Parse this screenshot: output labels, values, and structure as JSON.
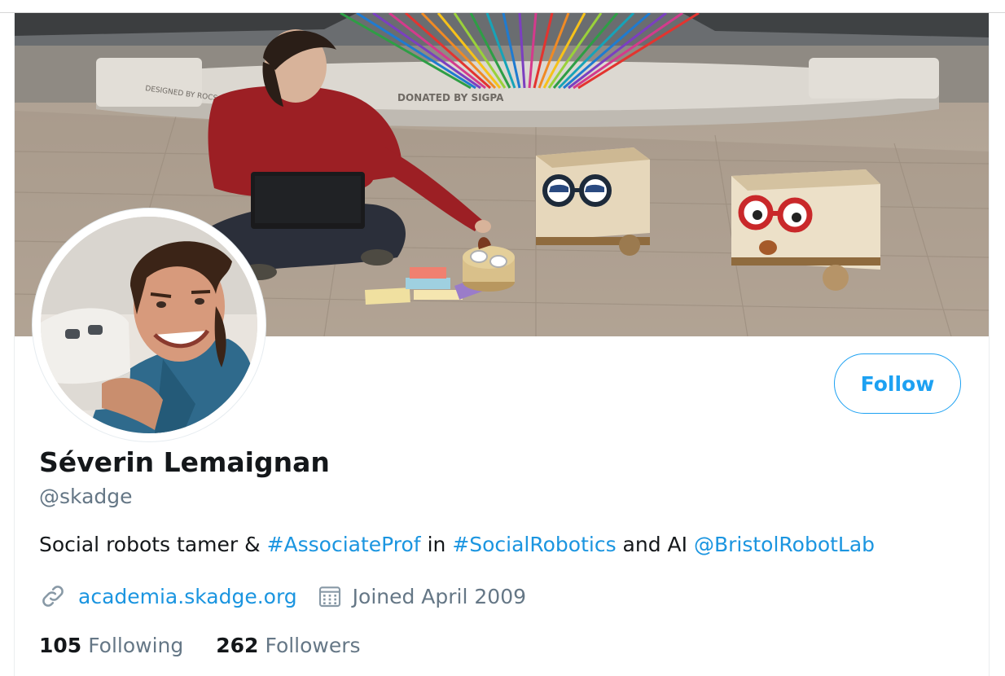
{
  "profile": {
    "display_name": "Séverin Lemaignan",
    "handle": "@skadge",
    "follow_label": "Follow",
    "bio": {
      "text_1": "Social robots tamer & ",
      "hashtag_1": "#AssociateProf",
      "text_2": " in ",
      "hashtag_2": "#SocialRobotics",
      "text_3": " and AI ",
      "mention": "@BristolRobotLab"
    },
    "website": "academia.skadge.org",
    "joined": "Joined April 2009",
    "following_count": "105",
    "following_label": "Following",
    "followers_count": "262",
    "followers_label": "Followers"
  },
  "banner": {
    "sign_left": "DESIGNED BY ROCS",
    "sign_center": "DONATED BY SIGPA"
  },
  "icons": {
    "website": "link-icon",
    "joined": "calendar-icon"
  },
  "colors": {
    "accent": "#1da1f2",
    "link": "#1b95e0",
    "text": "#14171a",
    "secondary": "#657786"
  }
}
